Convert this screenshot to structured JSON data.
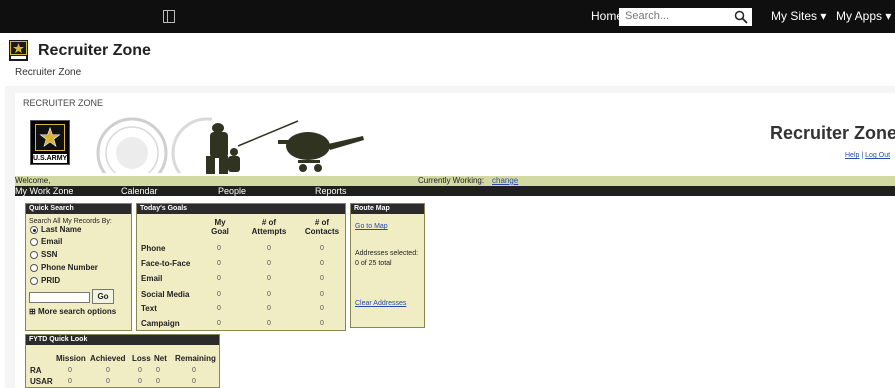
{
  "topbar": {
    "home": "Home",
    "search_placeholder": "Search...",
    "my_sites": "My Sites ▾",
    "my_apps": "My Apps ▾"
  },
  "site": {
    "title": "Recruiter Zone",
    "breadcrumb": "Recruiter Zone",
    "caption": "RECRUITER ZONE"
  },
  "banner": {
    "army_label": "U.S.ARMY",
    "title": "Recruiter Zone",
    "help": "Help",
    "separator": " | ",
    "logout": "Log Out"
  },
  "welcome": {
    "welcome": "Welcome,",
    "currently_working": "Currently Working:",
    "change": "change"
  },
  "nav": [
    "My Work Zone",
    "Calendar",
    "People",
    "Reports"
  ],
  "quick_search": {
    "header": "Quick Search",
    "prompt": "Search All My Records By:",
    "options": [
      "Last Name",
      "Email",
      "SSN",
      "Phone Number",
      "PRID"
    ],
    "selected": "Last Name",
    "go": "Go",
    "more": "More search options"
  },
  "todays_goals": {
    "header": "Today's Goals",
    "columns": [
      "My Goal",
      "# of Attempts",
      "# of Contacts"
    ],
    "rows": [
      {
        "label": "Phone",
        "values": [
          "0",
          "0",
          "0"
        ]
      },
      {
        "label": "Face-to-Face",
        "values": [
          "0",
          "0",
          "0"
        ]
      },
      {
        "label": "Email",
        "values": [
          "0",
          "0",
          "0"
        ]
      },
      {
        "label": "Social Media",
        "values": [
          "0",
          "0",
          "0"
        ]
      },
      {
        "label": "Text",
        "values": [
          "0",
          "0",
          "0"
        ]
      },
      {
        "label": "Campaign",
        "values": [
          "0",
          "0",
          "0"
        ]
      }
    ]
  },
  "route_map": {
    "header": "Route Map",
    "go_to_map": "Go to Map",
    "addresses_selected": "Addresses selected:",
    "count": "0 of 25 total",
    "clear": "Clear Addresses"
  },
  "fytd": {
    "header": "FYTD Quick Look",
    "columns": [
      "Mission",
      "Achieved",
      "Loss",
      "Net",
      "Remaining"
    ],
    "rows": [
      {
        "label": "RA",
        "values": [
          "0",
          "0",
          "0",
          "0",
          "0"
        ]
      },
      {
        "label": "USAR",
        "values": [
          "0",
          "0",
          "0",
          "0",
          "0"
        ]
      }
    ]
  },
  "colors": {
    "topbar": "#0f0f0f",
    "box_bg": "#f0ecc4",
    "welcome_strip": "#d2d9a3",
    "link": "#2a4dab"
  }
}
